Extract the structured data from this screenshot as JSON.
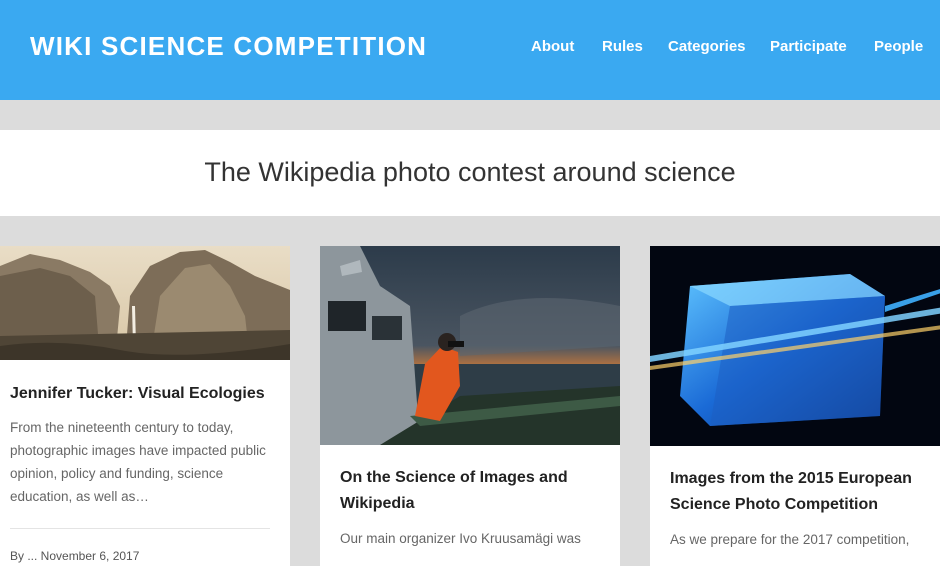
{
  "header": {
    "title": "WIKI SCIENCE COMPETITION",
    "nav": [
      "About",
      "Rules",
      "Categories",
      "Participate",
      "People"
    ]
  },
  "tagline": "The Wikipedia photo contest around science",
  "cards": [
    {
      "title": "Jennifer Tucker: Visual Ecologies",
      "excerpt": "From the nineteenth century to today, photographic images have impacted public opinion, policy and funding, science education, as well as…",
      "meta": "By ... November 6, 2017"
    },
    {
      "title": "On the Science of Images and Wikipedia",
      "excerpt": "Our main organizer Ivo Kruusamägi was"
    },
    {
      "title": "Images from the 2015 European Science Photo Competition",
      "excerpt": "As we prepare for the 2017 competition,"
    }
  ],
  "colors": {
    "header": "#3aa9f1",
    "background": "#dcdcdc",
    "card": "#ffffff"
  }
}
